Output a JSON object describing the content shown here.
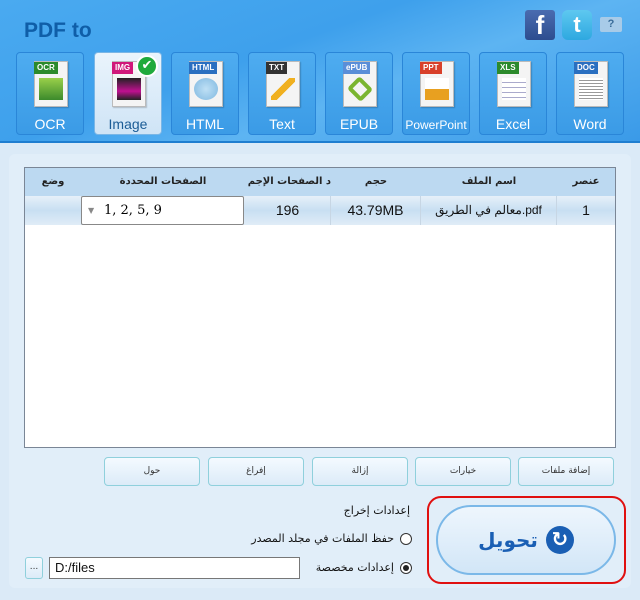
{
  "header": {
    "title": "PDF to",
    "social": {
      "facebook": "f",
      "twitter": "t",
      "help": "?"
    }
  },
  "formats": [
    {
      "label": "OCR",
      "tag": "OCR",
      "tag_color": "#2c8a2c",
      "active": false
    },
    {
      "label": "Image",
      "tag": "IMG",
      "tag_color": "#d0187a",
      "active": true,
      "check": "✔"
    },
    {
      "label": "HTML",
      "tag": "HTML",
      "tag_color": "#2a6fc0",
      "active": false
    },
    {
      "label": "Text",
      "tag": "TXT",
      "tag_color": "#333333",
      "active": false
    },
    {
      "label": "EPUB",
      "tag": "ePUB",
      "tag_color": "#5a8ed8",
      "active": false
    },
    {
      "label": "PowerPoint",
      "tag": "PPT",
      "tag_color": "#d8402a",
      "active": false
    },
    {
      "label": "Excel",
      "tag": "XLS",
      "tag_color": "#2c8a2c",
      "active": false
    },
    {
      "label": "Word",
      "tag": "DOC",
      "tag_color": "#2a6fc0",
      "active": false
    }
  ],
  "table": {
    "headers": {
      "index": "عنصر",
      "filename": "اسم الملف",
      "size": "حجم",
      "total_pages": "د الصفحات الإجم",
      "selected_pages": "الصفحات المحددة",
      "status": "وضع"
    },
    "rows": [
      {
        "index": "1",
        "filename": "معالم في الطريق.pdf",
        "size": "43.79MB",
        "total_pages": "196",
        "selected_pages": "1, 2, 5, 9",
        "status": ""
      }
    ]
  },
  "buttons": {
    "add_files": "إضافة ملفات",
    "options": "خيارات",
    "remove": "إزالة",
    "clear": "إفراغ",
    "about": "حول"
  },
  "output": {
    "label": "إعدادات إخراج",
    "option_source": "حفظ الملفات في مجلد المصدر",
    "option_custom": "إعدادات مخصصة",
    "selected": "custom",
    "path": "D:/files",
    "browse": "..."
  },
  "convert": {
    "label": "تحويل",
    "icon": "↻"
  }
}
